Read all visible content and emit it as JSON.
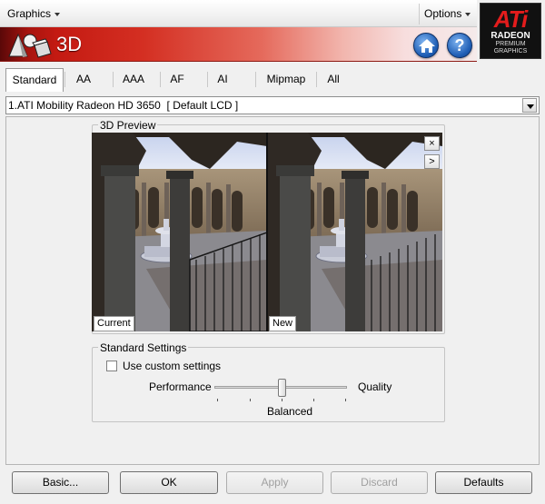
{
  "menubar": {
    "graphics_label": "Graphics",
    "options_label": "Options"
  },
  "header": {
    "title": "3D",
    "home_icon": "home-icon",
    "help_icon": "help-icon",
    "help_glyph": "?"
  },
  "logo": {
    "line1": "ATi",
    "line2": "RADEON",
    "line3": "PREMIUM",
    "line4": "GRAPHICS"
  },
  "tabs": [
    {
      "label": "Standard",
      "active": true
    },
    {
      "label": "AA"
    },
    {
      "label": "AAA"
    },
    {
      "label": "AF"
    },
    {
      "label": "AI"
    },
    {
      "label": "Mipmap"
    },
    {
      "label": "All"
    }
  ],
  "adapter": {
    "selected": "1.ATI Mobility Radeon HD 3650  [ Default LCD ]"
  },
  "preview": {
    "group_title": "3D Preview",
    "current_label": "Current",
    "new_label": "New",
    "close_glyph": "×",
    "next_glyph": ">"
  },
  "standard_settings": {
    "group_title": "Standard Settings",
    "custom_checkbox_label": "Use custom settings",
    "custom_checked": false,
    "slider_left_label": "Performance",
    "slider_right_label": "Quality",
    "slider_value_label": "Balanced"
  },
  "buttons": {
    "basic": "Basic...",
    "ok": "OK",
    "apply": "Apply",
    "discard": "Discard",
    "defaults": "Defaults"
  },
  "colors": {
    "header_red": "#c41a12",
    "ati_red": "#e31c1c"
  }
}
